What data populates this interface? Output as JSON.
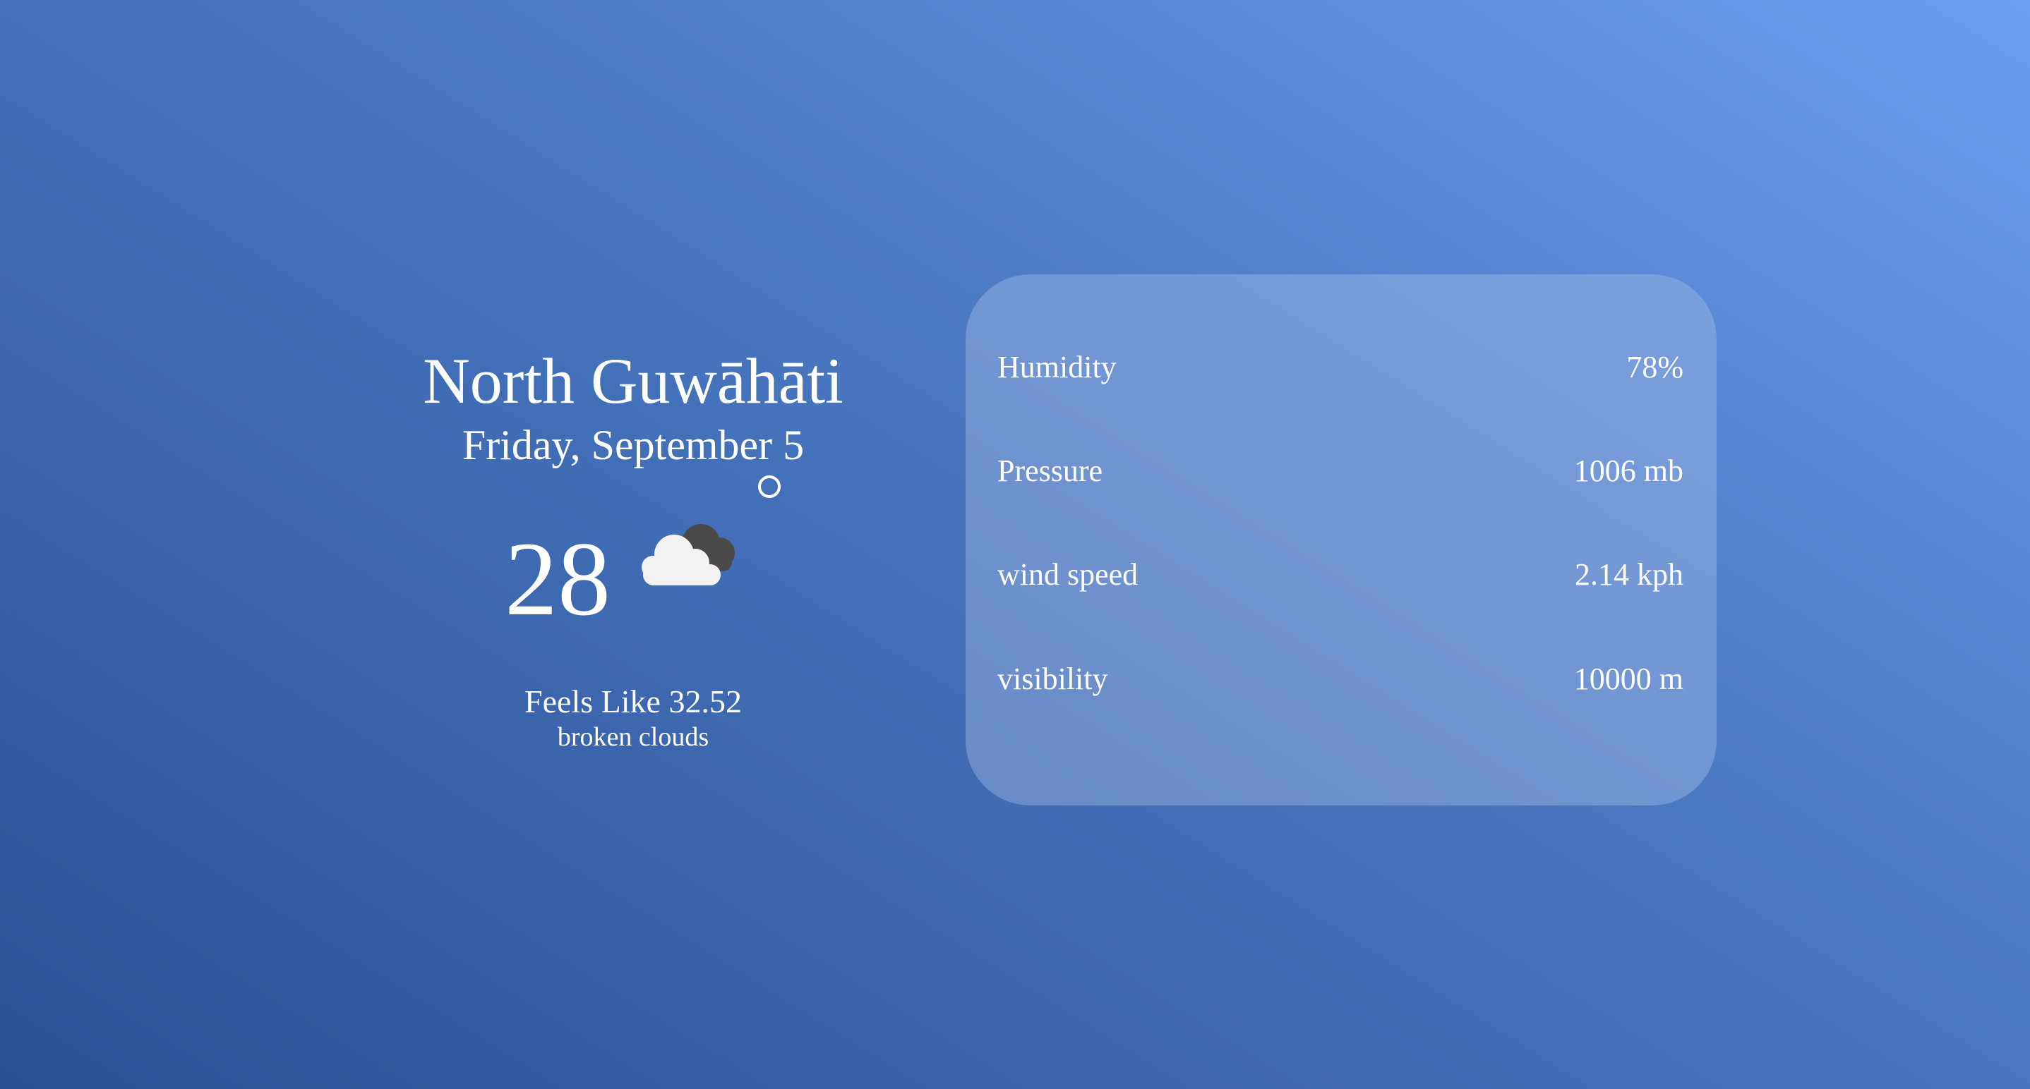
{
  "location": {
    "city": "North Guwāhāti",
    "date": "Friday, September 5"
  },
  "current": {
    "temperature": "28",
    "weather_icon": "broken-clouds-icon",
    "feels_like": "Feels Like 32.52",
    "description": "broken clouds"
  },
  "stats": [
    {
      "label": "Humidity",
      "value": "78%"
    },
    {
      "label": "Pressure",
      "value": "1006 mb"
    },
    {
      "label": "wind speed",
      "value": "2.14 kph"
    },
    {
      "label": "visibility",
      "value": "10000 m"
    }
  ]
}
